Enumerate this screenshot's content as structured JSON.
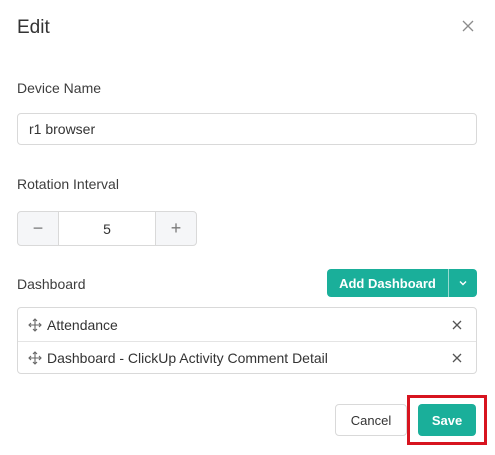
{
  "dialog": {
    "title": "Edit",
    "close_icon": "close-icon"
  },
  "device_name": {
    "label": "Device Name",
    "value": "r1 browser"
  },
  "rotation_interval": {
    "label": "Rotation Interval",
    "value": "5",
    "decrement_symbol": "−",
    "increment_symbol": "+"
  },
  "dashboard": {
    "label": "Dashboard",
    "add_button_label": "Add Dashboard",
    "items": [
      {
        "name": "Attendance"
      },
      {
        "name": "Dashboard - ClickUp Activity Comment Detail"
      }
    ]
  },
  "footer": {
    "cancel_label": "Cancel",
    "save_label": "Save",
    "highlight_color": "#d7141f"
  },
  "colors": {
    "accent": "#1aaf9a"
  }
}
